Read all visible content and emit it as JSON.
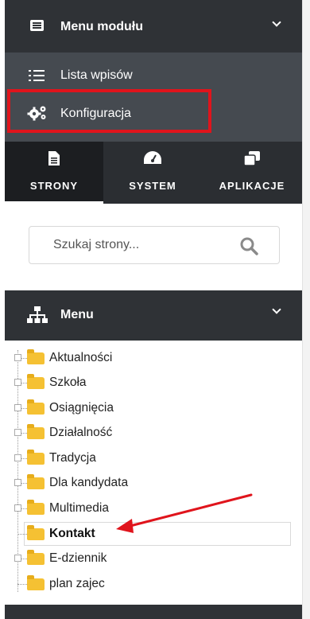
{
  "module_menu": {
    "title": "Menu modułu",
    "items": [
      {
        "label": "Lista wpisów",
        "icon": "list-icon"
      },
      {
        "label": "Konfiguracja",
        "icon": "gears-icon"
      }
    ]
  },
  "tabs": [
    {
      "label": "STRONY",
      "icon": "file-icon",
      "active": true
    },
    {
      "label": "SYSTEM",
      "icon": "dashboard-icon",
      "active": false
    },
    {
      "label": "APLIKACJE",
      "icon": "clone-icon",
      "active": false
    }
  ],
  "search": {
    "placeholder": "Szukaj strony..."
  },
  "menu": {
    "title": "Menu",
    "tree": [
      {
        "label": "Aktualności",
        "expandable": true
      },
      {
        "label": "Szkoła",
        "expandable": true
      },
      {
        "label": "Osiągnięcia",
        "expandable": true
      },
      {
        "label": "Działalność",
        "expandable": true
      },
      {
        "label": "Tradycja",
        "expandable": true
      },
      {
        "label": "Dla kandydata",
        "expandable": true
      },
      {
        "label": "Multimedia",
        "expandable": true
      },
      {
        "label": "Kontakt",
        "expandable": false,
        "selected": true
      },
      {
        "label": "E-dziennik",
        "expandable": true
      },
      {
        "label": "plan zajec",
        "expandable": false
      }
    ]
  },
  "colors": {
    "header_bg": "#2f3236",
    "submenu_bg": "#454a50",
    "highlight": "#e0141c",
    "folder": "#f5c133",
    "arrow": "#e0141c"
  }
}
